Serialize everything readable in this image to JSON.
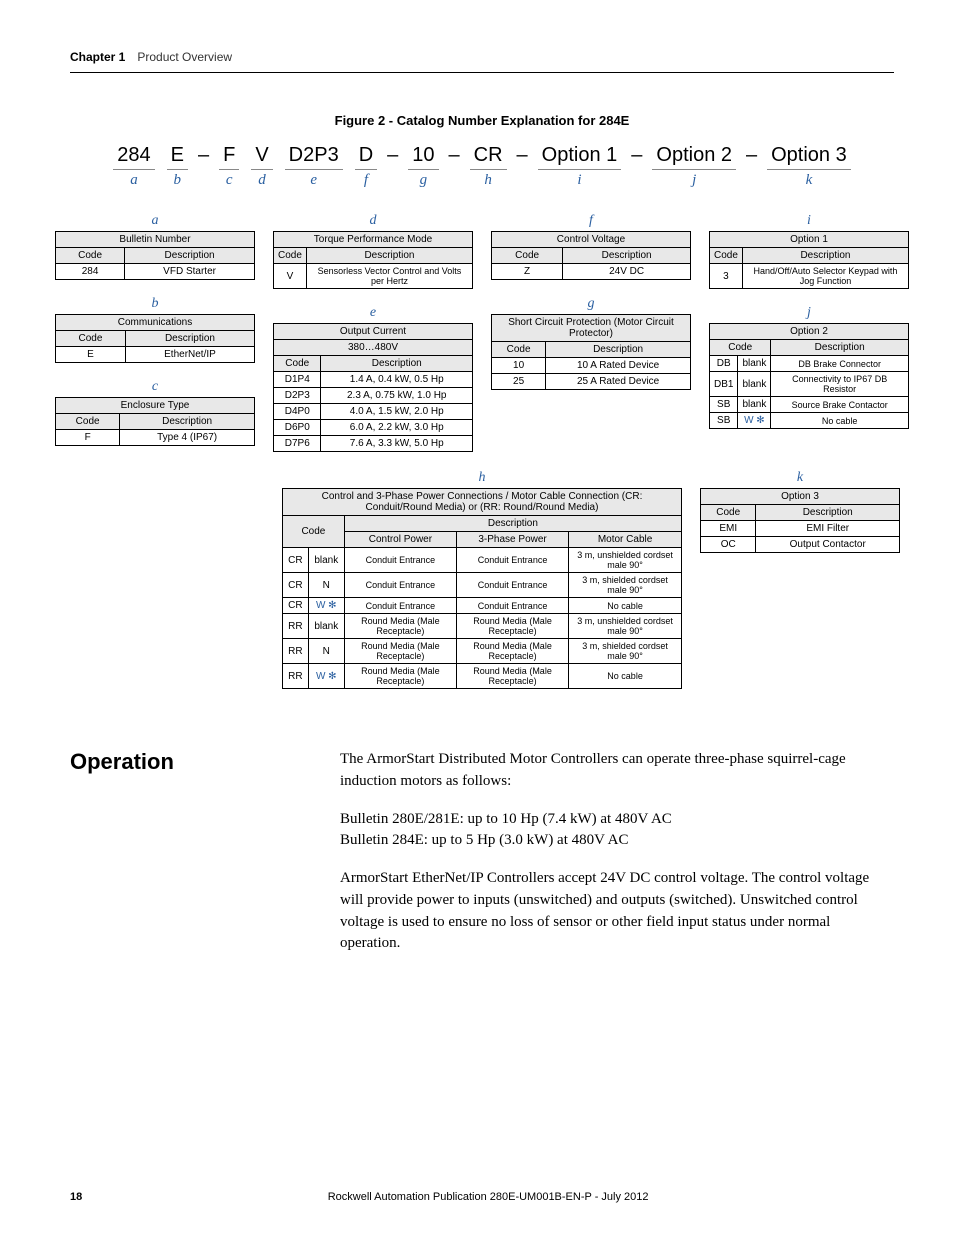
{
  "header": {
    "chapter_label": "Chapter 1",
    "chapter_title": "Product Overview"
  },
  "figure_title": "Figure 2 - Catalog Number Explanation for 284E",
  "catalog": [
    {
      "text": "284",
      "letter": "a"
    },
    {
      "text": "E",
      "letter": "b"
    },
    {
      "sep": "–"
    },
    {
      "text": "F",
      "letter": "c"
    },
    {
      "text": "V",
      "letter": "d"
    },
    {
      "text": "D2P3",
      "letter": "e"
    },
    {
      "text": "D",
      "letter": "f"
    },
    {
      "sep": "–"
    },
    {
      "text": "10",
      "letter": "g"
    },
    {
      "sep": "–"
    },
    {
      "text": "CR",
      "letter": "h"
    },
    {
      "sep": "–"
    },
    {
      "text": "Option 1",
      "letter": "i"
    },
    {
      "sep": "–"
    },
    {
      "text": "Option 2",
      "letter": "j"
    },
    {
      "sep": "–"
    },
    {
      "text": "Option 3",
      "letter": "k"
    }
  ],
  "tables": {
    "a": {
      "letter": "a",
      "title": "Bulletin Number",
      "headers": [
        "Code",
        "Description"
      ],
      "rows": [
        [
          "284",
          "VFD Starter"
        ]
      ]
    },
    "b": {
      "letter": "b",
      "title": "Communications",
      "headers": [
        "Code",
        "Description"
      ],
      "rows": [
        [
          "E",
          "EtherNet/IP"
        ]
      ]
    },
    "c": {
      "letter": "c",
      "title": "Enclosure Type",
      "headers": [
        "Code",
        "Description"
      ],
      "rows": [
        [
          "F",
          "Type 4 (IP67)"
        ]
      ]
    },
    "d": {
      "letter": "d",
      "title": "Torque Performance Mode",
      "headers": [
        "Code",
        "Description"
      ],
      "rows": [
        [
          "V",
          "Sensorless Vector Control and Volts per Hertz"
        ]
      ]
    },
    "e": {
      "letter": "e",
      "title": "Output Current",
      "subtitle": "380…480V",
      "headers": [
        "Code",
        "Description"
      ],
      "rows": [
        [
          "D1P4",
          "1.4 A, 0.4 kW, 0.5 Hp"
        ],
        [
          "D2P3",
          "2.3 A, 0.75 kW, 1.0 Hp"
        ],
        [
          "D4P0",
          "4.0 A, 1.5 kW, 2.0 Hp"
        ],
        [
          "D6P0",
          "6.0 A, 2.2 kW, 3.0 Hp"
        ],
        [
          "D7P6",
          "7.6 A, 3.3 kW, 5.0 Hp"
        ]
      ]
    },
    "f": {
      "letter": "f",
      "title": "Control Voltage",
      "headers": [
        "Code",
        "Description"
      ],
      "rows": [
        [
          "Z",
          "24V DC"
        ]
      ]
    },
    "g": {
      "letter": "g",
      "title": "Short Circuit Protection (Motor Circuit Protector)",
      "headers": [
        "Code",
        "Description"
      ],
      "rows": [
        [
          "10",
          "10 A Rated Device"
        ],
        [
          "25",
          "25 A Rated Device"
        ]
      ]
    },
    "h": {
      "letter": "h",
      "title": "Control and 3-Phase Power Connections / Motor Cable Connection (CR: Conduit/Round Media) or (RR: Round/Round Media)",
      "headers_top": [
        "Code",
        "Description"
      ],
      "sub_headers": [
        "Control Power",
        "3-Phase Power",
        "Motor Cable"
      ],
      "rows": [
        [
          "CR",
          "blank",
          "Conduit Entrance",
          "Conduit Entrance",
          "3 m, unshielded cordset male 90°"
        ],
        [
          "CR",
          "N",
          "Conduit Entrance",
          "Conduit Entrance",
          "3 m, shielded cordset male 90°"
        ],
        [
          "CR",
          "W ✻",
          "Conduit Entrance",
          "Conduit Entrance",
          "No cable"
        ],
        [
          "RR",
          "blank",
          "Round Media (Male Receptacle)",
          "Round Media (Male Receptacle)",
          "3 m, unshielded cordset male 90°"
        ],
        [
          "RR",
          "N",
          "Round Media (Male Receptacle)",
          "Round Media (Male Receptacle)",
          "3 m, shielded cordset male 90°"
        ],
        [
          "RR",
          "W ✻",
          "Round Media (Male Receptacle)",
          "Round Media (Male Receptacle)",
          "No cable"
        ]
      ]
    },
    "i": {
      "letter": "i",
      "title": "Option 1",
      "headers": [
        "Code",
        "Description"
      ],
      "rows": [
        [
          "3",
          "Hand/Off/Auto Selector Keypad with Jog Function"
        ]
      ]
    },
    "j": {
      "letter": "j",
      "title": "Option 2",
      "headers": [
        "Code",
        "Description"
      ],
      "rows": [
        [
          "DB",
          "blank",
          "DB Brake Connector"
        ],
        [
          "DB1",
          "blank",
          "Connectivity to IP67 DB Resistor"
        ],
        [
          "SB",
          "blank",
          "Source Brake Contactor"
        ],
        [
          "SB",
          "W ✻",
          "No cable"
        ]
      ]
    },
    "k": {
      "letter": "k",
      "title": "Option 3",
      "headers": [
        "Code",
        "Description"
      ],
      "rows": [
        [
          "EMI",
          "EMI Filter"
        ],
        [
          "OC",
          "Output Contactor"
        ]
      ]
    }
  },
  "operation": {
    "heading": "Operation",
    "p1": "The ArmorStart Distributed Motor Controllers can operate three-phase squirrel-cage induction motors as follows:",
    "p2a": "Bulletin 280E/281E: up to 10 Hp (7.4 kW) at 480V AC",
    "p2b": "Bulletin 284E: up to 5 Hp (3.0 kW) at 480V AC",
    "p3": "ArmorStart EtherNet/IP Controllers accept 24V DC control voltage. The control voltage will provide power to inputs (unswitched) and outputs (switched). Unswitched control voltage is used to ensure no loss of sensor or other field input status under normal operation."
  },
  "footer": {
    "page": "18",
    "pub": "Rockwell Automation Publication 280E-UM001B-EN-P - July 2012"
  }
}
